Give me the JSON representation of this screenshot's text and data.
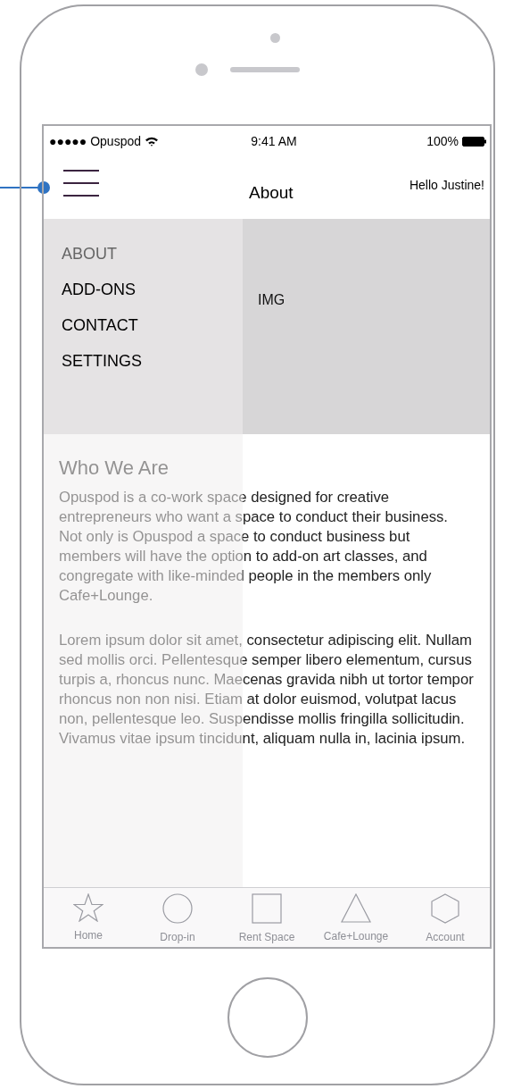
{
  "status_bar": {
    "carrier": "●●●●● Opuspod",
    "time": "9:41 AM",
    "battery": "100%"
  },
  "nav_bar": {
    "title": "About",
    "greeting": "Hello Justine!"
  },
  "menu": {
    "items": [
      {
        "label": "ABOUT",
        "selected": true
      },
      {
        "label": "ADD-ONS",
        "selected": false
      },
      {
        "label": "CONTACT",
        "selected": false
      },
      {
        "label": "SETTINGS",
        "selected": false
      }
    ]
  },
  "hero": {
    "label": "IMG"
  },
  "section": {
    "heading": "Who We Are",
    "paragraphs": [
      "Opuspod is a co-work space designed for creative entrepreneurs who want a space to conduct their business. Not only is Opuspod a space to conduct business but members will have the option to add-on art classes, and congregate with like-minded people in the members only Cafe+Lounge.",
      "Lorem ipsum dolor sit amet, consectetur adipiscing elit. Nullam sed mollis orci. Pellentesque semper libero elementum, cursus turpis a, rhoncus nunc. Maecenas gravida nibh ut tortor tempor rhoncus non non nisi. Etiam at dolor euismod, volutpat lacus non, pellentesque leo. Suspendisse mollis fringilla sollicitudin. Vivamus vitae ipsum tincidunt, aliquam nulla in, lacinia ipsum."
    ]
  },
  "tab_bar": {
    "tabs": [
      {
        "label": "Home",
        "kind": "star"
      },
      {
        "label": "Drop-in",
        "kind": "circle"
      },
      {
        "label": "Rent Space",
        "kind": "square"
      },
      {
        "label": "Cafe+Lounge",
        "kind": "triangle"
      },
      {
        "label": "Account",
        "kind": "hexagon"
      }
    ]
  }
}
